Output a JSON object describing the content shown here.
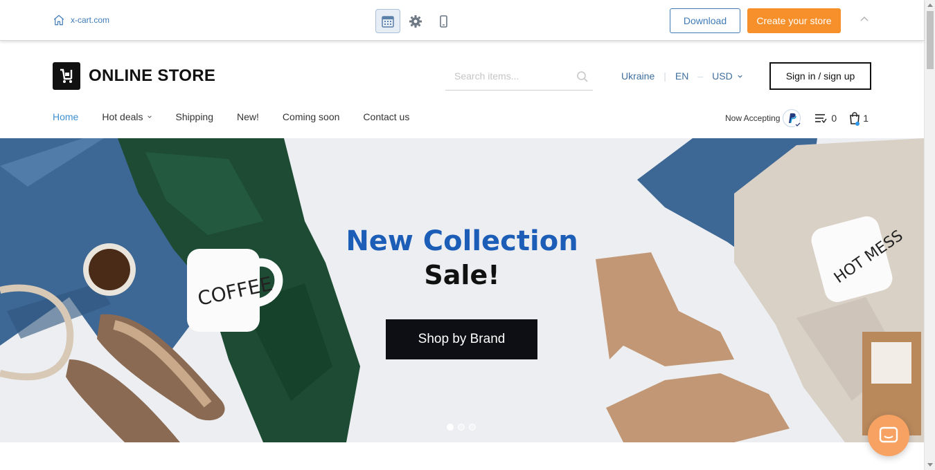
{
  "demo_bar": {
    "site_link": "x-cart.com",
    "tools": [
      "calendar-icon",
      "gear-icon",
      "mobile-icon"
    ],
    "download_label": "Download",
    "create_label": "Create your store"
  },
  "header": {
    "logo_text": "ONLINE STORE",
    "search_placeholder": "Search items...",
    "country": "Ukraine",
    "language": "EN",
    "currency": "USD",
    "signin_label": "Sign in / sign up"
  },
  "nav": {
    "items": [
      {
        "label": "Home",
        "active": true
      },
      {
        "label": "Hot deals",
        "dropdown": true
      },
      {
        "label": "Shipping"
      },
      {
        "label": "New!"
      },
      {
        "label": "Coming soon"
      },
      {
        "label": "Contact us"
      }
    ],
    "now_accepting": "Now Accepting",
    "compare_count": "0",
    "cart_count": "1"
  },
  "banner": {
    "title": "New Collection",
    "subtitle": "Sale!",
    "button_label": "Shop by Brand",
    "slides": 3,
    "active_slide": 1
  },
  "colors": {
    "accent_blue": "#3f7ab7",
    "orange": "#f7902b",
    "title_blue": "#1b5db7"
  }
}
